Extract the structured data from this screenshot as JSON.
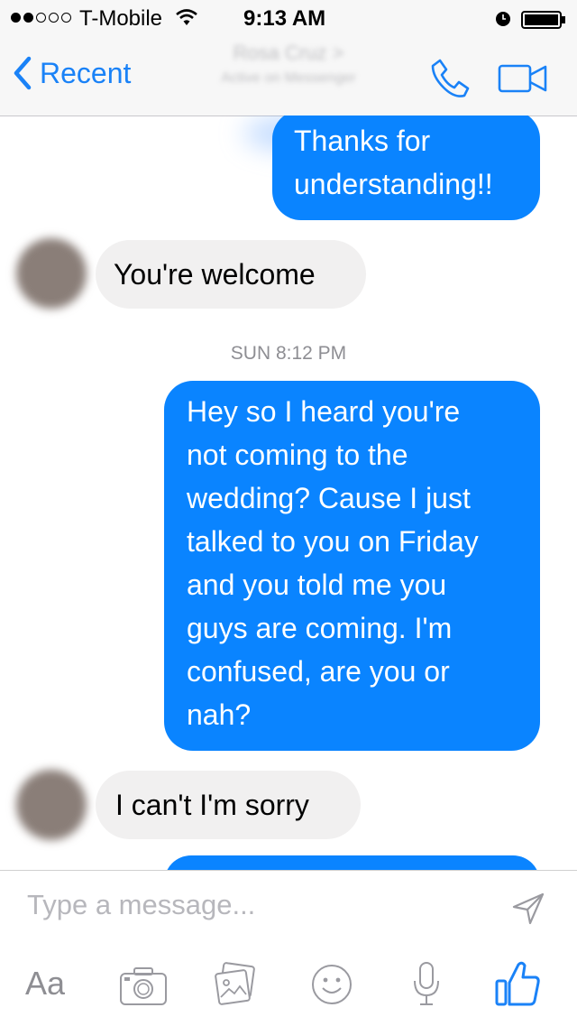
{
  "status_bar": {
    "carrier": "T-Mobile",
    "time": "9:13 AM"
  },
  "nav": {
    "back_label": "Recent",
    "contact_name": "Rosa Cruz >",
    "contact_sub": "Active on Messenger"
  },
  "messages": [
    {
      "direction": "out",
      "lines": [
        "Thanks for",
        "understanding!!"
      ]
    },
    {
      "direction": "in",
      "lines": [
        "You're welcome"
      ]
    },
    {
      "type": "timestamp",
      "text": "SUN 8:12 PM"
    },
    {
      "direction": "out",
      "lines": [
        "Hey so I heard you're",
        "not coming to the",
        "wedding? Cause I just",
        "talked to you on Friday",
        "and you told me you",
        "guys are coming. I'm",
        "confused, are you or",
        "nah?"
      ]
    },
    {
      "direction": "in",
      "lines": [
        "I can't I'm sorry"
      ]
    }
  ],
  "composer": {
    "placeholder": "Type a message...",
    "aa_label": "Aa"
  },
  "icons": {
    "back": "chevron-left-icon",
    "call": "phone-icon",
    "video": "video-camera-icon",
    "send": "send-arrow-icon",
    "camera": "camera-icon",
    "gallery": "photo-gallery-icon",
    "emoji": "smiley-icon",
    "mic": "microphone-icon",
    "like": "thumbs-up-icon"
  },
  "colors": {
    "accent": "#1a82f7",
    "outgoing_bubble": "#0a84ff",
    "incoming_bubble": "#f1f0f0",
    "bar_bg": "#f7f7f7"
  }
}
